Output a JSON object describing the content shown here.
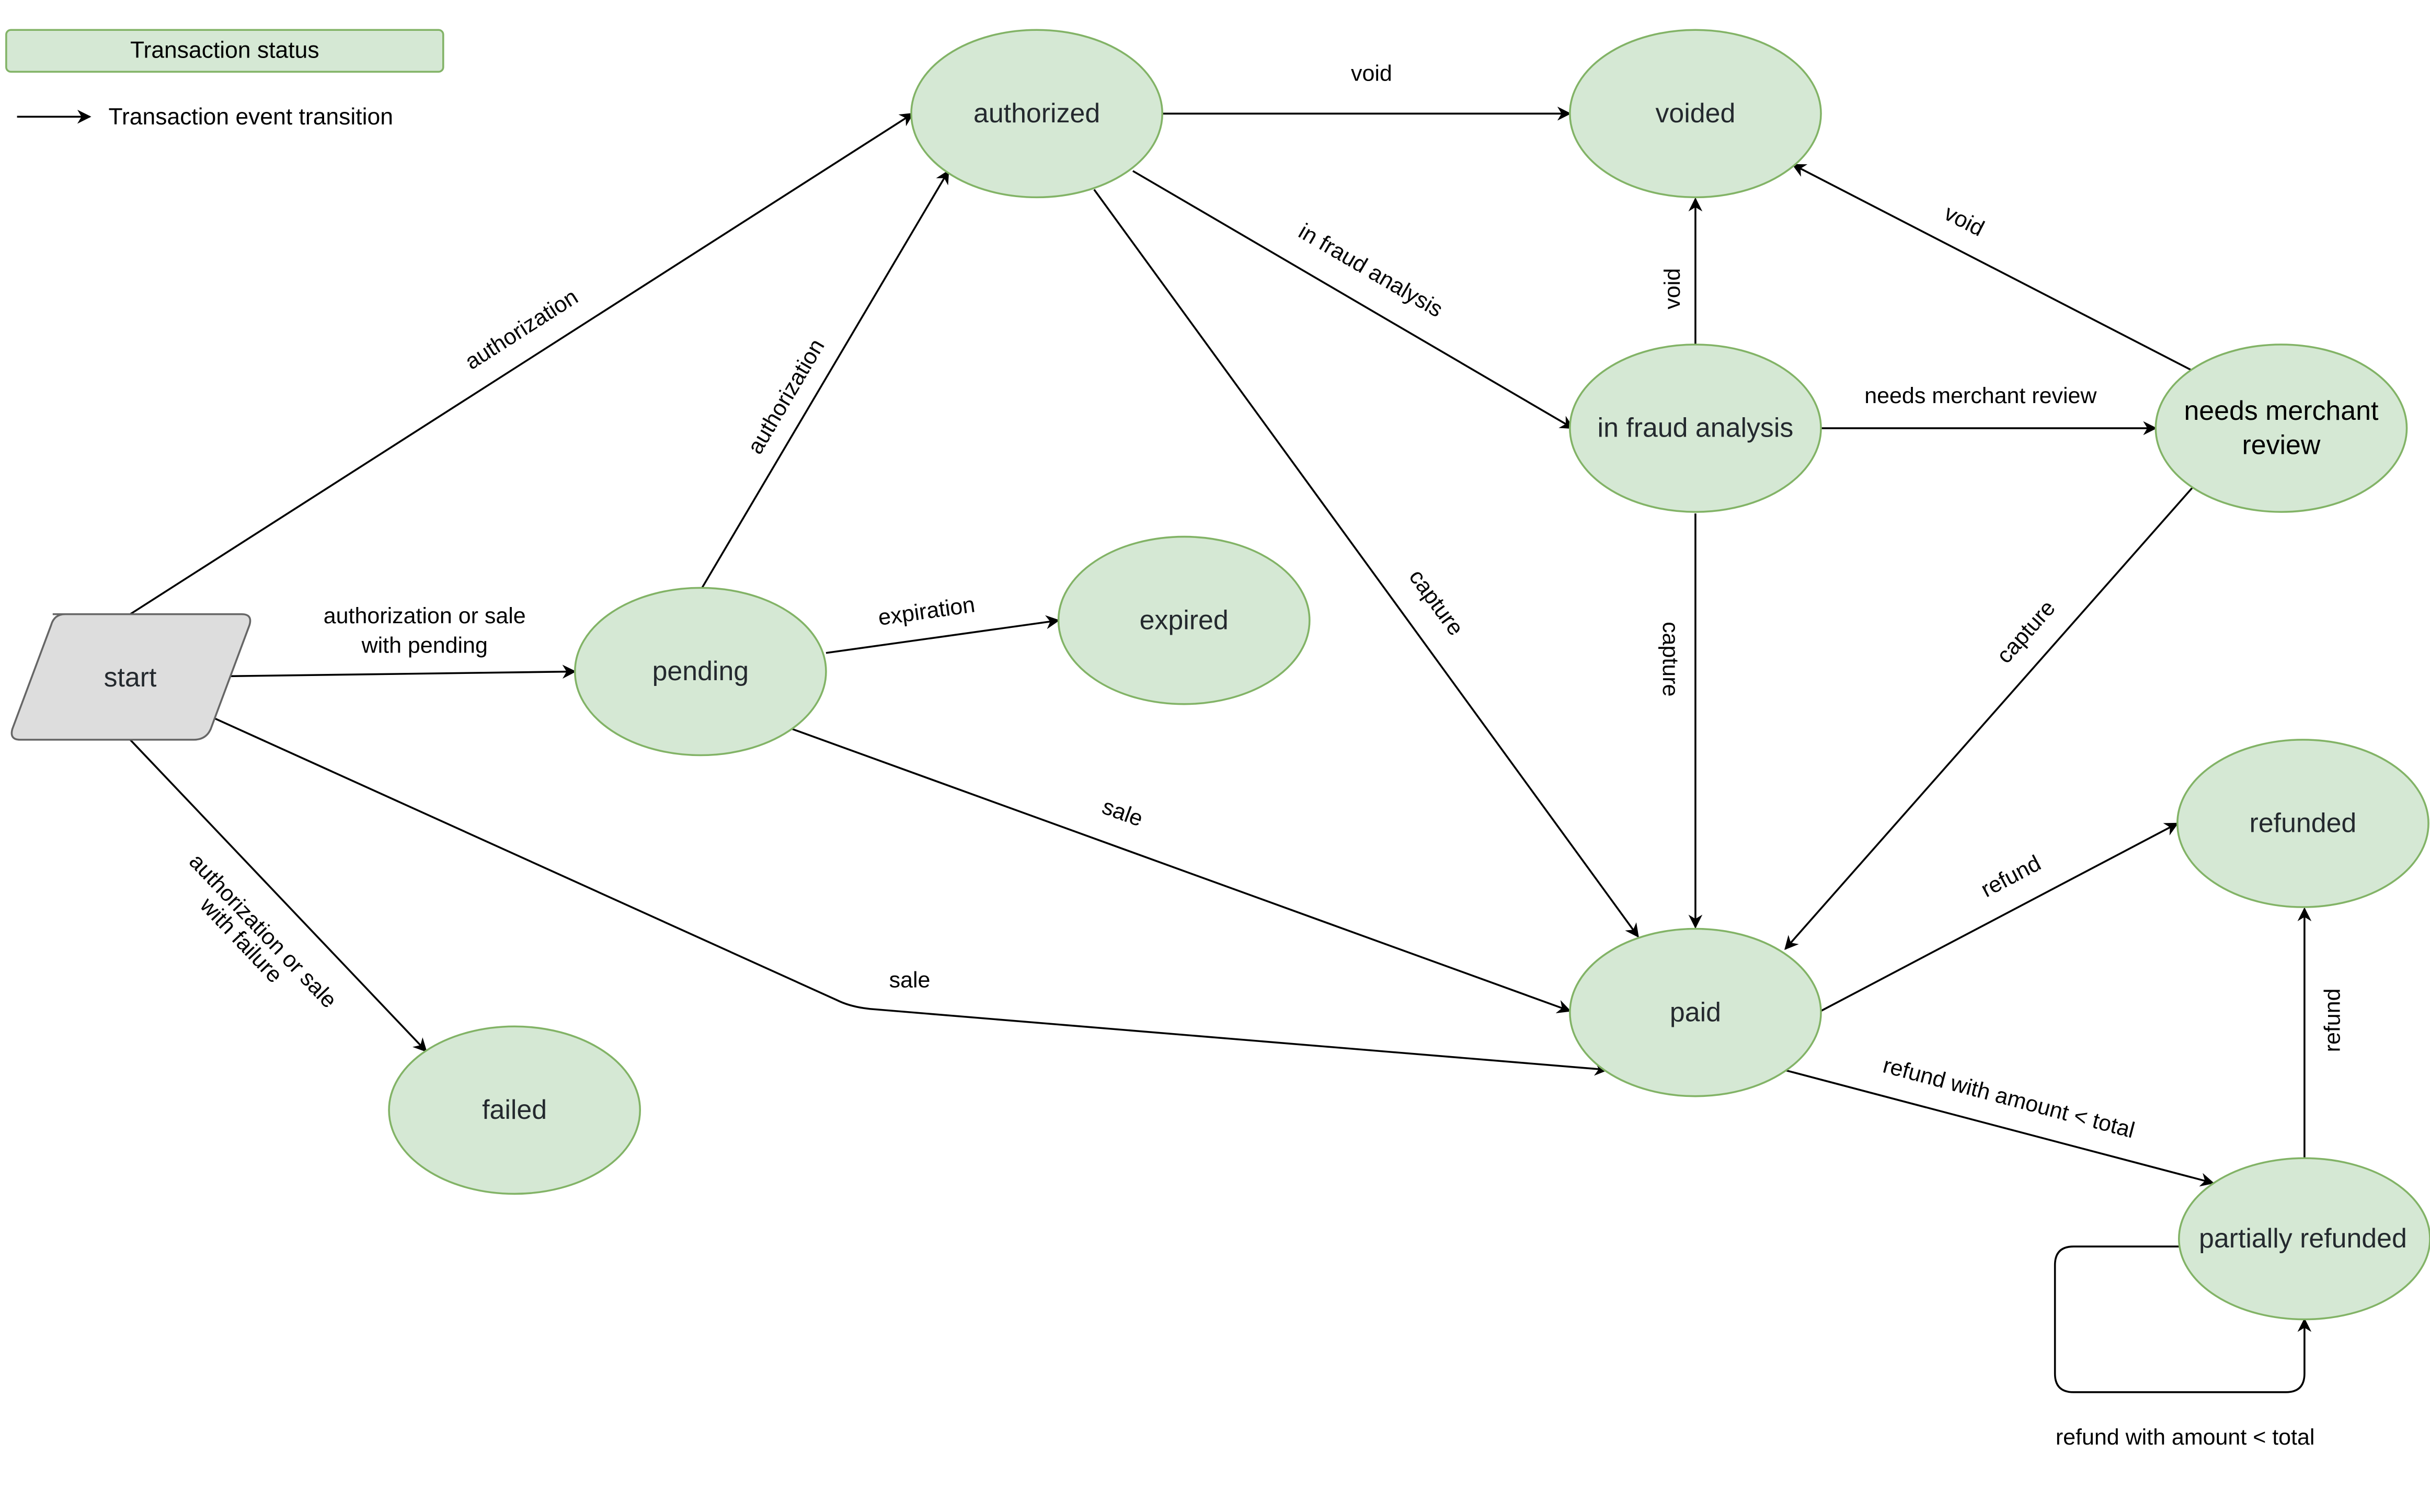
{
  "legend": {
    "status_label": "Transaction status",
    "transition_label": "Transaction event transition",
    "status_fill": "#d5e8d4",
    "status_stroke": "#82b366"
  },
  "colors": {
    "state_fill": "#d5e8d4",
    "state_stroke": "#82b366",
    "start_fill": "#dddddd",
    "start_stroke": "#666666",
    "edge": "#000000"
  },
  "nodes": {
    "start": "start",
    "pending": "pending",
    "authorized": "authorized",
    "voided": "voided",
    "expired": "expired",
    "in_fraud_analysis": "in fraud analysis",
    "needs_merchant_review_1": "needs merchant",
    "needs_merchant_review_2": "review",
    "failed": "failed",
    "paid": "paid",
    "refunded": "refunded",
    "partially_refunded": "partially refunded"
  },
  "edges": {
    "start_authorized": "authorization",
    "start_pending_1": "authorization or sale",
    "start_pending_2": "with pending",
    "start_failed_1": "authorization or sale",
    "start_failed_2": "with failure",
    "start_paid": "sale",
    "pending_authorized": "authorization",
    "pending_expired": "expiration",
    "pending_paid": "sale",
    "authorized_voided": "void",
    "authorized_fraud": "in fraud analysis",
    "authorized_paid": "capture",
    "fraud_voided": "void",
    "fraud_review": "needs merchant review",
    "fraud_paid": "capture",
    "review_voided": "void",
    "review_paid": "capture",
    "paid_refunded": "refund",
    "paid_partial": "refund with amount < total",
    "partial_refunded": "refund",
    "partial_self": "refund with amount < total"
  }
}
